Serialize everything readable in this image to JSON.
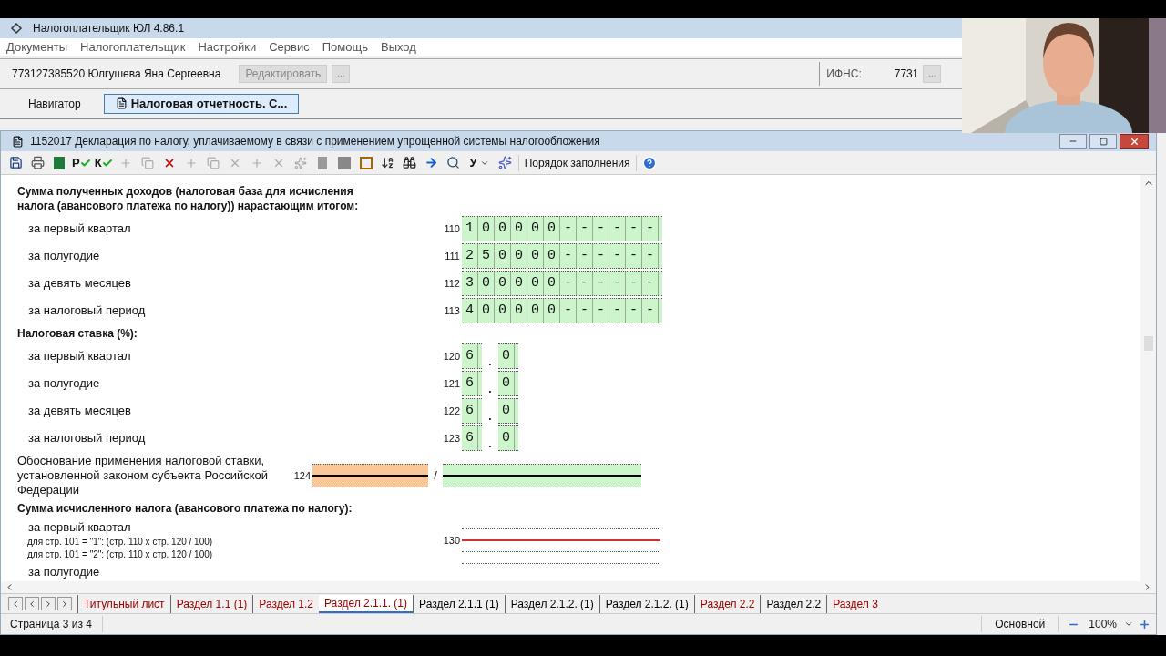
{
  "app": {
    "title": "Налогоплательщик ЮЛ 4.86.1"
  },
  "menu": [
    "Документы",
    "Налогоплательщик",
    "Настройки",
    "Сервис",
    "Помощь",
    "Выход"
  ],
  "taxpayer": {
    "name": "773127385520 Юлгушева Яна Сергеевна",
    "edit_button": "Редактировать",
    "more_button": "...",
    "ifns_label": "ИФНС:",
    "ifns_value": "7731",
    "ifns_button": "..."
  },
  "nav_tabs": [
    {
      "label": "Навигатор",
      "selected": false
    },
    {
      "label": "Налоговая отчетность. С...",
      "selected": true
    }
  ],
  "document": {
    "title": "1152017 Декларация по налогу, уплачиваемому в связи с применением упрощенной системы налогообложения",
    "toolbar": {
      "check_p": "Р",
      "check_k": "К",
      "font_menu": "У",
      "fill_order": "Порядок заполнения"
    },
    "items": [
      {
        "kind": "heading",
        "text": "Сумма полученных доходов (налоговая база для исчисления налога (авансового платежа по налогу)) нарастающим итогом:"
      },
      {
        "kind": "amount",
        "label": "за первый квартал",
        "code": "110",
        "value": "100000------"
      },
      {
        "kind": "amount",
        "label": "за полугодие",
        "code": "111",
        "value": "250000------"
      },
      {
        "kind": "amount",
        "label": "за девять месяцев",
        "code": "112",
        "value": "300000------"
      },
      {
        "kind": "amount",
        "label": "за налоговый период",
        "code": "113",
        "value": "400000------"
      },
      {
        "kind": "heading",
        "text": "Налоговая ставка (%):"
      },
      {
        "kind": "rate",
        "label": "за первый квартал",
        "code": "120",
        "integer": "6",
        "separator": ".",
        "fraction": "0"
      },
      {
        "kind": "rate",
        "label": "за полугодие",
        "code": "121",
        "integer": "6",
        "separator": ".",
        "fraction": "0"
      },
      {
        "kind": "rate",
        "label": "за девять месяцев",
        "code": "122",
        "integer": "6",
        "separator": ".",
        "fraction": "0"
      },
      {
        "kind": "rate",
        "label": "за налоговый период",
        "code": "123",
        "integer": "6",
        "separator": ".",
        "fraction": "0"
      },
      {
        "kind": "basis",
        "label": "Обоснование применения налоговой ставки, установленной законом субъекта Российской Федерации",
        "code": "124",
        "separator": "/"
      },
      {
        "kind": "heading",
        "text": "Сумма исчисленного налога (авансового платежа по налогу):"
      },
      {
        "kind": "formula",
        "label": "за первый квартал",
        "code": "130",
        "notes": [
          "для стр. 101 = \"1\": (стр. 110 x стр. 120 / 100)",
          "для стр. 101 = \"2\": (стр. 110 x стр. 120 / 100)"
        ]
      },
      {
        "kind": "blank",
        "label": "за полугодие"
      }
    ],
    "sheet_tabs": [
      {
        "label": "Титульный лист",
        "selected": false,
        "color": "#a00000"
      },
      {
        "label": "Раздел 1.1 (1)",
        "selected": false,
        "color": "#a00000"
      },
      {
        "label": "Раздел 1.2",
        "selected": false,
        "color": "#a00000"
      },
      {
        "label": "Раздел 2.1.1. (1)",
        "selected": true,
        "color": "#a00000"
      },
      {
        "label": "Раздел 2.1.1 (1)",
        "selected": false,
        "color": "#000000"
      },
      {
        "label": "Раздел 2.1.2. (1)",
        "selected": false,
        "color": "#000000"
      },
      {
        "label": "Раздел 2.1.2. (1)",
        "selected": false,
        "color": "#000000"
      },
      {
        "label": "Раздел 2.2",
        "selected": false,
        "color": "#a00000"
      },
      {
        "label": "Раздел 2.2",
        "selected": false,
        "color": "#000000"
      },
      {
        "label": "Раздел 3",
        "selected": false,
        "color": "#a00000"
      }
    ],
    "status": {
      "page": "Страница 3 из 4",
      "mode": "Основной",
      "zoom": "100%"
    }
  }
}
